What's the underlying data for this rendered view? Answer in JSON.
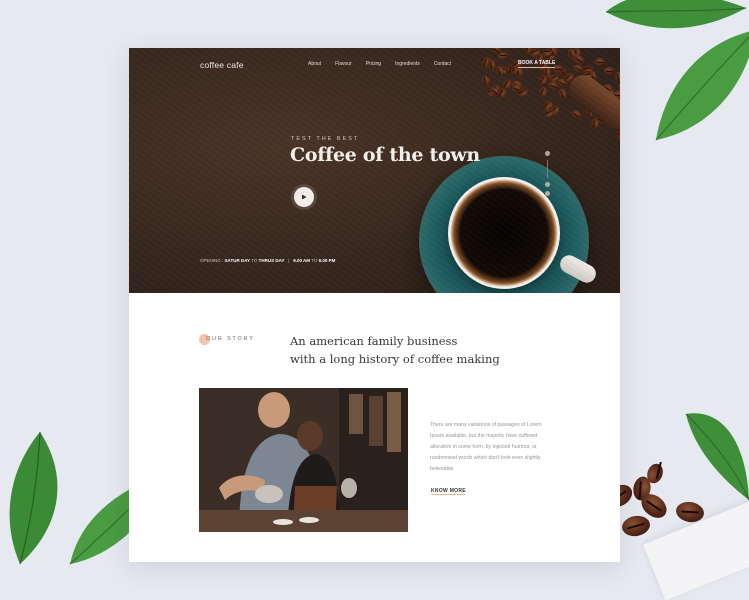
{
  "brand": {
    "logo": "coffee cafe"
  },
  "nav": {
    "items": [
      "About",
      "Flavour",
      "Pricing",
      "Ingredients",
      "Contact"
    ],
    "cta": "BOOK A TABLE"
  },
  "hero": {
    "eyebrow": "TEST THE BEST",
    "title": "Coffee of the town",
    "opening_label": "OPENING :",
    "opening_days_from": "SATUR DAY",
    "opening_days_to_word": "TO",
    "opening_days_to": "THRUS DAY",
    "separator": "|",
    "opening_time_from": "9.00 AM",
    "opening_time_to_word": "TO",
    "opening_time_to": "9.00 PM",
    "social_icons": [
      "twitter-icon",
      "facebook-icon",
      "instagram-icon"
    ]
  },
  "story": {
    "label": "OUR STORY",
    "tagline_line1": "An american family business",
    "tagline_line2": "with a long history of coffee making",
    "paragraph": "There are many variations of passages of Lorem Ipsum available, but the majority have suffered alteration in some form, by injected humour, or randomised words which don't look even slightly believable.",
    "more_label": "KNOW MORE"
  },
  "colors": {
    "hero_bg": "#2b1e17",
    "accent": "#f2c4ad",
    "page_bg": "#e6e9f0"
  }
}
